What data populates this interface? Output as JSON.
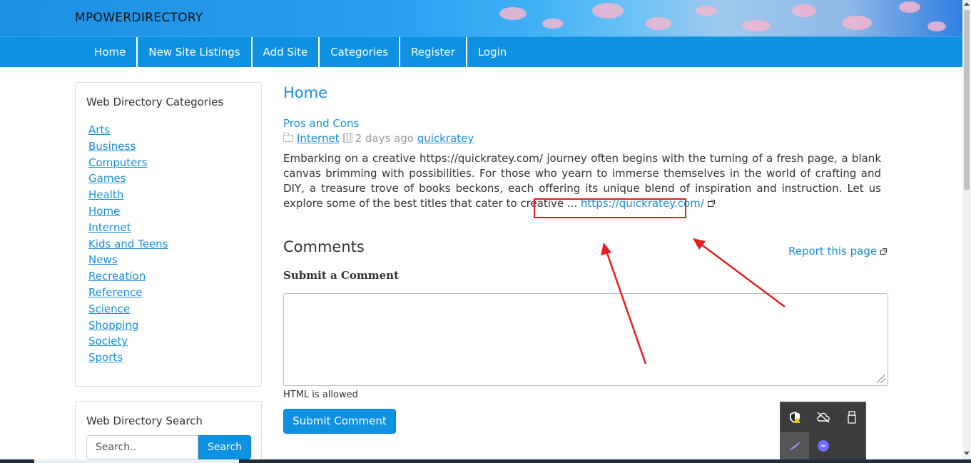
{
  "site": {
    "brand": "MPOWERDIRECTORY"
  },
  "nav": {
    "items": [
      {
        "label": "Home"
      },
      {
        "label": "New Site Listings"
      },
      {
        "label": "Add Site"
      },
      {
        "label": "Categories"
      },
      {
        "label": "Register"
      },
      {
        "label": "Login"
      }
    ]
  },
  "sidebar": {
    "categories_title": "Web Directory Categories",
    "categories": [
      "Arts",
      "Business",
      "Computers",
      "Games",
      "Health",
      "Home",
      "Internet",
      "Kids and Teens",
      "News",
      "Recreation",
      "Reference",
      "Science",
      "Shopping",
      "Society",
      "Sports"
    ],
    "search_title": "Web Directory Search",
    "search_placeholder": "Search..",
    "search_button": "Search"
  },
  "main": {
    "page_title": "Home",
    "post": {
      "title": "Pros and Cons",
      "category": "Internet",
      "date": "2 days ago",
      "author": "quickratey",
      "excerpt": "Embarking on a creative https://quickratey.com/ journey often begins with the turning of a fresh page, a blank canvas brimming with possibilities. For those who yearn to immerse themselves in the world of crafting and DIY, a treasure trove of books beckons, each offering its unique blend of inspiration and instruction. Let us explore some of the best titles that cater to creative ... ",
      "link_text": "https://quickratey.com/"
    },
    "comments": {
      "heading": "Comments",
      "report_link": "Report this page",
      "submit_heading": "Submit a Comment",
      "textarea_value": "",
      "html_note": "HTML is allowed",
      "submit_button": "Submit Comment"
    }
  },
  "tray": {
    "icons": [
      "security-warning-icon",
      "cloud-offline-icon",
      "usb-drive-icon",
      "pen-icon",
      "messenger-icon"
    ]
  },
  "colors": {
    "accent": "#0f91e2",
    "link": "#1a8ed8",
    "annotation": "#e41e1e"
  }
}
